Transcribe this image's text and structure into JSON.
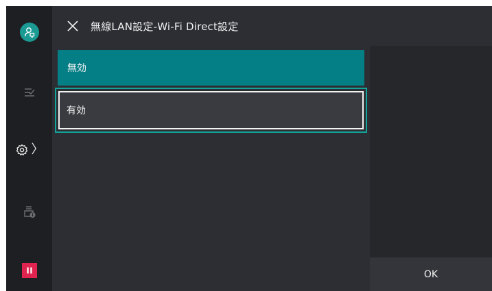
{
  "header": {
    "title": "無線LAN設定-Wi-Fi Direct設定"
  },
  "options": [
    {
      "label": "無効",
      "state": "highlighted"
    },
    {
      "label": "有効",
      "state": "focused"
    }
  ],
  "actions": {
    "ok_label": "OK"
  },
  "rail": {
    "items": [
      {
        "icon": "user-login-icon"
      },
      {
        "icon": "job-flow-icon"
      },
      {
        "icon": "gear-icon",
        "chevron": "〉"
      },
      {
        "icon": "device-info-icon"
      },
      {
        "icon": "pause-icon"
      }
    ]
  },
  "colors": {
    "accent": "#047f86",
    "focus_border": "#13a49b",
    "pause": "#e0244f"
  }
}
